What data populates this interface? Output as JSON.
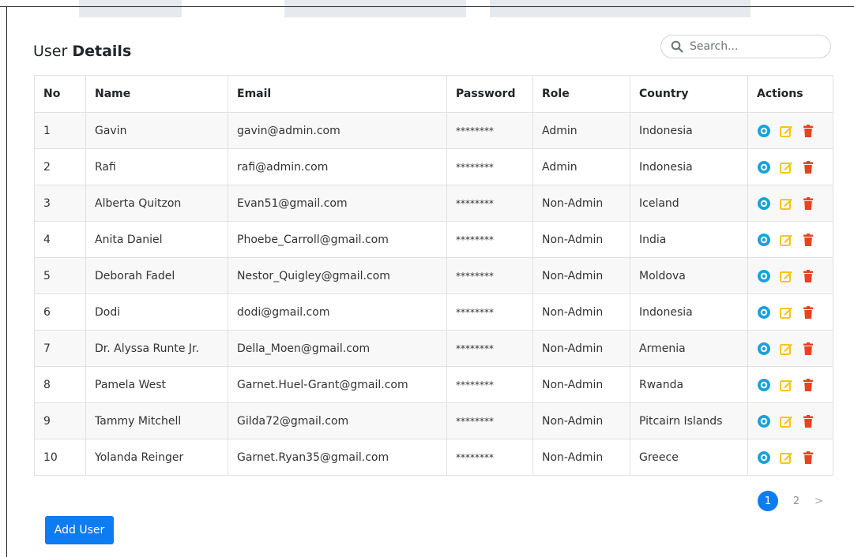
{
  "header": {
    "title_regular": "User ",
    "title_bold": "Details"
  },
  "search": {
    "placeholder": "Search...",
    "icon": "search-icon"
  },
  "table": {
    "columns": [
      "No",
      "Name",
      "Email",
      "Password",
      "Role",
      "Country",
      "Actions"
    ],
    "rows": [
      {
        "no": "1",
        "name": "Gavin",
        "email": "gavin@admin.com",
        "password": "********",
        "role": "Admin",
        "country": "Indonesia"
      },
      {
        "no": "2",
        "name": "Rafi",
        "email": "rafi@admin.com",
        "password": "********",
        "role": "Admin",
        "country": "Indonesia"
      },
      {
        "no": "3",
        "name": "Alberta Quitzon",
        "email": "Evan51@gmail.com",
        "password": "********",
        "role": "Non-Admin",
        "country": "Iceland"
      },
      {
        "no": "4",
        "name": "Anita Daniel",
        "email": "Phoebe_Carroll@gmail.com",
        "password": "********",
        "role": "Non-Admin",
        "country": "India"
      },
      {
        "no": "5",
        "name": "Deborah Fadel",
        "email": "Nestor_Quigley@gmail.com",
        "password": "********",
        "role": "Non-Admin",
        "country": "Moldova"
      },
      {
        "no": "6",
        "name": "Dodi",
        "email": "dodi@gmail.com",
        "password": "********",
        "role": "Non-Admin",
        "country": "Indonesia"
      },
      {
        "no": "7",
        "name": "Dr. Alyssa Runte Jr.",
        "email": "Della_Moen@gmail.com",
        "password": "********",
        "role": "Non-Admin",
        "country": "Armenia"
      },
      {
        "no": "8",
        "name": "Pamela West",
        "email": "Garnet.Huel-Grant@gmail.com",
        "password": "********",
        "role": "Non-Admin",
        "country": "Rwanda"
      },
      {
        "no": "9",
        "name": "Tammy Mitchell",
        "email": "Gilda72@gmail.com",
        "password": "********",
        "role": "Non-Admin",
        "country": "Pitcairn Islands"
      },
      {
        "no": "10",
        "name": "Yolanda Reinger",
        "email": "Garnet.Ryan35@gmail.com",
        "password": "********",
        "role": "Non-Admin",
        "country": "Greece"
      }
    ],
    "actions": [
      {
        "icon": "view-icon",
        "color": "#17a2d8"
      },
      {
        "icon": "edit-icon",
        "color": "#f5c518"
      },
      {
        "icon": "delete-icon",
        "color": "#e8421e"
      }
    ]
  },
  "pagination": {
    "pages": [
      "1",
      "2"
    ],
    "current": "1",
    "next": ">"
  },
  "footer": {
    "add_user_label": "Add User"
  },
  "colors": {
    "primary": "#0d7bf2",
    "view": "#17a2d8",
    "edit": "#f5c518",
    "delete": "#e8421e"
  }
}
